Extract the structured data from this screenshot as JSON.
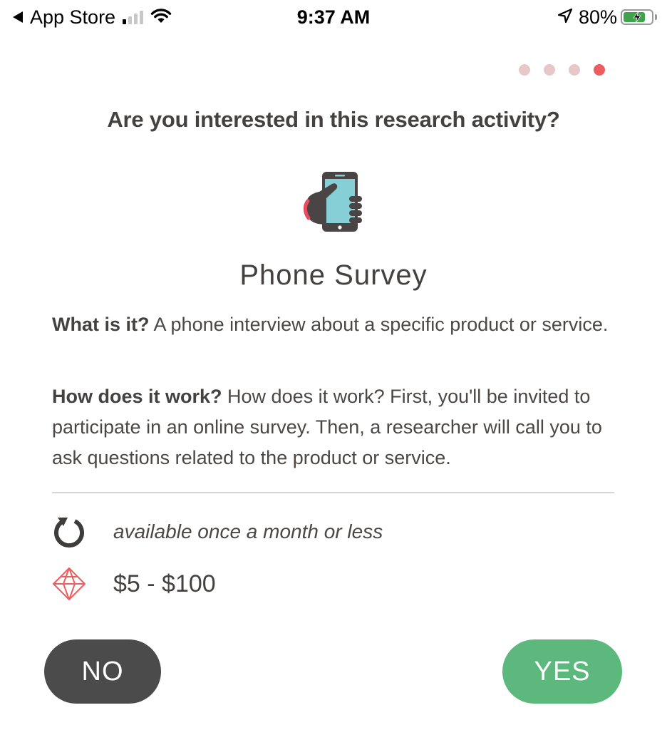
{
  "status_bar": {
    "back_label": "App Store",
    "time": "9:37 AM",
    "battery_percent": "80%",
    "battery_level": 0.8,
    "signal_bars_active": 1,
    "signal_bars_total": 4,
    "icons": [
      "back-arrow-icon",
      "signal-icon",
      "wifi-icon",
      "location-icon",
      "battery-charging-icon"
    ]
  },
  "pager": {
    "total": 4,
    "active_index": 3,
    "colors": {
      "inactive": "#e8c7c9",
      "active": "#ec5d5f"
    }
  },
  "question": "Are you interested in this research activity?",
  "activity": {
    "icon": "hand-holding-phone-icon",
    "title": "Phone Survey",
    "what_label": "What is it?",
    "what_text": " A phone interview about a specific product or service.",
    "how_label": "How does it work?",
    "how_text": " How does it work? First, you'll be invited to participate in an online survey. Then, a researcher will call you to ask questions related to the product or service."
  },
  "details": {
    "frequency": {
      "icon": "refresh-icon",
      "text": "available once a month or less"
    },
    "reward": {
      "icon": "diamond-icon",
      "text": "$5 - $100"
    }
  },
  "buttons": {
    "no_label": "NO",
    "yes_label": "YES"
  },
  "colors": {
    "no_button": "#4b4b4b",
    "yes_button": "#5cb87d",
    "accent": "#ec5d5f",
    "text": "#444240"
  }
}
